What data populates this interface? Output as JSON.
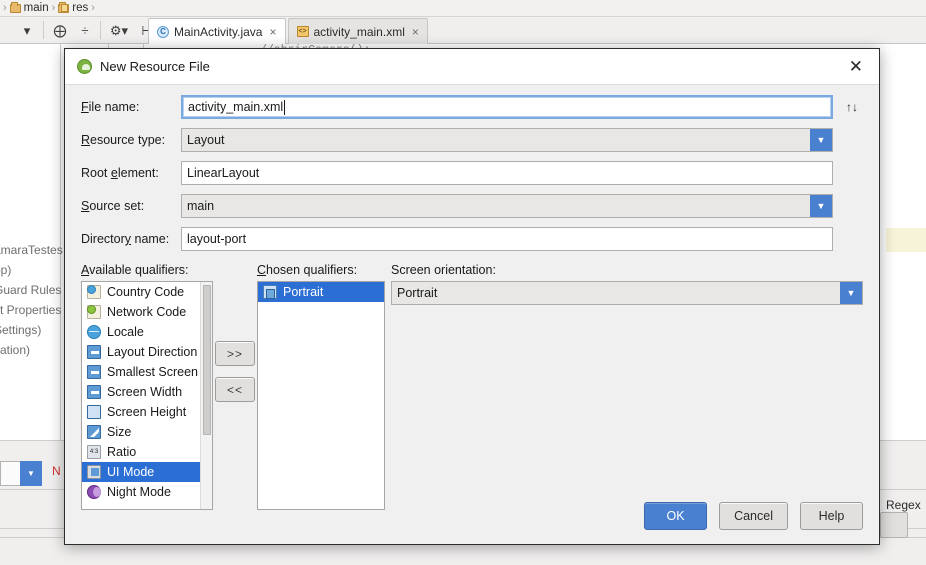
{
  "ide": {
    "breadcrumb": [
      {
        "label": "main",
        "icon": "folder-icon"
      },
      {
        "label": "res",
        "icon": "folder-res-icon"
      }
    ],
    "toolbar_icons": [
      "dropdown-arrow-icon",
      "target-icon",
      "divide-icon",
      "gear-icon",
      "indent-icon"
    ],
    "tabs": [
      {
        "label": "MainActivity.java",
        "icon": "java-class-icon",
        "active": true,
        "close": "×"
      },
      {
        "label": "activity_main.xml",
        "icon": "xml-file-icon",
        "active": false,
        "close": "×"
      }
    ],
    "editor_snippet": "//abrirCamera();",
    "project_tree_fragments": [
      "amaraTestes",
      "pp)",
      "Guard Rules",
      "ct Properties",
      "Settings)",
      "cation)"
    ],
    "bottom_combo_arrow": "▼",
    "bottom_red_text": "N",
    "bottom_right_text": "Regex"
  },
  "dialog": {
    "title": "New Resource File",
    "title_icon": "android-icon",
    "close_label": "✕",
    "fields": [
      {
        "id": "file-name",
        "label": "File name:",
        "underline_index": 0,
        "type": "text",
        "value": "activity_main.xml",
        "focused": true
      },
      {
        "id": "resource-type",
        "label": "Resource type:",
        "underline_index": 0,
        "type": "combo",
        "value": "Layout"
      },
      {
        "id": "root-element",
        "label": "Root element:",
        "underline_index": 5,
        "type": "text",
        "value": "LinearLayout"
      },
      {
        "id": "source-set",
        "label": "Source set:",
        "underline_index": 0,
        "type": "combo",
        "value": "main"
      },
      {
        "id": "directory-name",
        "label": "Directory name:",
        "underline_index": 10,
        "type": "text",
        "value": "layout-port"
      }
    ],
    "updown_icon": "↑↓",
    "available_label": "Available qualifiers:",
    "chosen_label": "Chosen qualifiers:",
    "orientation_label": "Screen orientation:",
    "orientation_value": "Portrait",
    "available_qualifiers": [
      {
        "label": "Country Code",
        "icon": "country-code-icon"
      },
      {
        "label": "Network Code",
        "icon": "network-code-icon"
      },
      {
        "label": "Locale",
        "icon": "locale-globe-icon"
      },
      {
        "label": "Layout Direction",
        "icon": "layout-direction-icon"
      },
      {
        "label": "Smallest Screen W",
        "icon": "smallest-screen-width-icon"
      },
      {
        "label": "Screen Width",
        "icon": "screen-width-icon"
      },
      {
        "label": "Screen Height",
        "icon": "screen-height-icon"
      },
      {
        "label": "Size",
        "icon": "size-icon"
      },
      {
        "label": "Ratio",
        "icon": "ratio-icon",
        "badge": "4:3"
      },
      {
        "label": "UI Mode",
        "icon": "ui-mode-icon",
        "selected": true
      },
      {
        "label": "Night Mode",
        "icon": "night-mode-icon"
      }
    ],
    "chosen_qualifiers": [
      {
        "label": "Portrait",
        "icon": "portrait-icon",
        "selected": true
      }
    ],
    "move_right_label": ">>",
    "move_left_label": "<<",
    "buttons": [
      {
        "id": "ok",
        "label": "OK",
        "primary": true
      },
      {
        "id": "cancel",
        "label": "Cancel",
        "primary": false
      },
      {
        "id": "help",
        "label": "Help",
        "primary": false
      }
    ]
  },
  "colors": {
    "accent_blue": "#4a80d0",
    "selection_blue": "#2b6fd4",
    "dialog_bg": "#f0f0f0",
    "highlight_yellow": "#f7f3d8"
  }
}
